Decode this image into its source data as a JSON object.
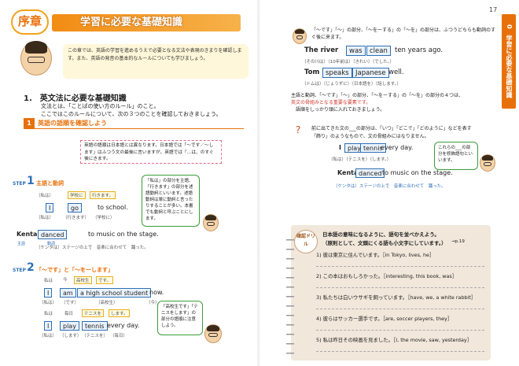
{
  "left": {
    "badge": "序章",
    "title": "学習に必要な基礎知識",
    "intro": "この章では、英語の学習を進めるうえで必要となる文法や表現のきまりを確認します。また、英語の発音の基本的なルールについても学びましょう。",
    "section_title": "1.　英文法に必要な基礎知識",
    "section_l1": "文法とは、「ことばの使い方のルール」のこと。",
    "section_l2": "ここではこのルールについて、次の３つのことを確認しておきましょう。",
    "heading_num": "1",
    "heading_label": "英語の語順を確認しよう",
    "pink_text": "英語の語順は日本語とは異なります。日本語では「～です／～します」はふつう文の最後に言いますが、英語では「…は、のすぐ後にきます。",
    "step1": {
      "num": "1",
      "title": "主語と動詞",
      "jp_row": [
        "（私は）",
        "学校に",
        "行きます。"
      ],
      "en_row": [
        "I",
        "go",
        "to school."
      ],
      "gl_row": [
        "（私は）",
        "（行きます）",
        "（学校に）"
      ],
      "kenta": [
        "Kenta",
        "danced",
        "to music on the stage."
      ],
      "kenta_gloss": "（ケンタは）ステージの上で　音楽に合わせて　踊った。",
      "lbl_subject": "主語",
      "lbl_verb": "動詞"
    },
    "note1": "「私は」の部分を主語、「行きます」の部分を述語動詞といいます。述語動詞は単に動詞と言ったりすることが多い。本書でも動詞と呼ぶことにします。",
    "step2": {
      "num": "2",
      "title": "「～です」と「～をーします」",
      "r1_jp": [
        "私は",
        "今",
        "高校生",
        "です。"
      ],
      "r1_en": [
        "I",
        "am",
        "a high school student",
        "now."
      ],
      "r1_gl": [
        "（私は）",
        "（です）",
        "（高校生）",
        "（今）"
      ],
      "r2_jp": [
        "私は",
        "毎日",
        "テニスを",
        "します。"
      ],
      "r2_en": [
        "I",
        "play",
        "tennis",
        "every day."
      ],
      "r2_gl": [
        "（私は）",
        "（します）",
        "（テニスを）",
        "（毎日）"
      ]
    },
    "note2": "「高校生です」「テニスをします」の部分の語順に注意しよう。",
    "step_label": "STEP"
  },
  "right": {
    "page_number": "17",
    "side_tab": "0　学習に必要な基礎知識",
    "intro": "「～です」「～」の部分、「～をーする」の「～を」の部分は、ふつうどちらも動詞のすぐ後に来ます。",
    "ex1": [
      "The river",
      "was",
      "clean",
      "ten years ago."
    ],
    "ex1_gl": "（その川は）（10年前は）（きれい）（でした。）",
    "ex2": [
      "Tom",
      "speaks",
      "Japanese",
      "well."
    ],
    "ex2_gl": "（トムは）（じょうずに）（日本語を）（話します。）",
    "p2": "主語と動詞、「～です」「～」の部分、「～をーする」の「～を」の部分の４つは、英文の骨組みとなる重要な要素です。語順をしっかり頭に入れておきましょう。",
    "p2_l1": "主語と動詞、「～です」「～」の部分、「～をーする」の「～を」の部分の４つは、",
    "p2_l2": "英文の骨組みとなる重要な要素です。",
    "p2_l3": "語順をしっかり頭に入れておきましょう。",
    "q_intro1": "前に出てきた文の___の部分は、「いつ」「どこで」「どのように」などを表す",
    "q_intro2": "「飾り」のようなもので、文の骨組みにはなりません。",
    "ex3": [
      "I",
      "play",
      "tennis",
      "every day."
    ],
    "ex3_gl": "（私は）（テニスを）（します。）",
    "ex4": [
      "Kenta",
      "danced",
      "to music on the stage."
    ],
    "ex4_gl": "（ケンタは）ステージの上で　音楽に合わせて　踊った。",
    "bubble": "これらの___の部分を修飾語句といいます。",
    "drill": {
      "badge": "確認ドリル",
      "instruction1": "日本語の意味になるように、語句を並べかえよう。",
      "instruction2": "（原則として、文頭にくる語も小文字にしています。）",
      "ref": "→p.19",
      "questions": [
        "1) 彼は東京に住んでいます。［in Tokyo, lives, he］",
        "2) この本はおもしろかった。［interesting, this book, was］",
        "3) 私たちは白いウサギを飼っています。［have, we, a white rabbit］",
        "4) 彼らはサッカー選手です。［are, soccer players, they］",
        "5) 私は昨日その映画を見ました。［I, the movie, saw, yesterday］"
      ]
    }
  },
  "colors": {
    "accent": "#e8700a",
    "blue": "#2f6fb5",
    "drill_bg": "#f1e7da"
  }
}
